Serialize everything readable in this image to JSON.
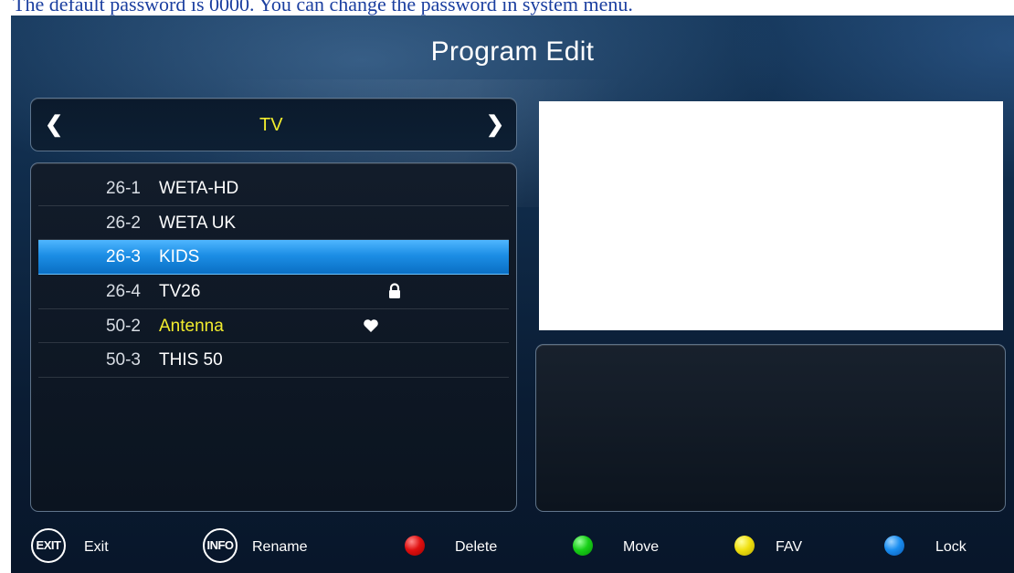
{
  "note": "The default password is 0000. You can change the password in system menu.",
  "screen": {
    "title": "Program Edit",
    "group": {
      "label": "TV",
      "prev_icon": "chevron-left-icon",
      "next_icon": "chevron-right-icon"
    },
    "channels": [
      {
        "number": "26-1",
        "name": "WETA-HD"
      },
      {
        "number": "26-2",
        "name": "WETA UK"
      },
      {
        "number": "26-3",
        "name": "KIDS",
        "selected": true
      },
      {
        "number": "26-4",
        "name": "TV26",
        "flag_icon": "lock-icon"
      },
      {
        "number": "50-2",
        "name": "Antenna",
        "favorite": true,
        "flag_icon": "heart-icon"
      },
      {
        "number": "50-3",
        "name": "THIS 50"
      }
    ],
    "footer": {
      "exit": {
        "button": "EXIT",
        "label": "Exit"
      },
      "info": {
        "button": "INFO",
        "label": "Rename"
      },
      "delete": {
        "label": "Delete",
        "color": "#e01010"
      },
      "move": {
        "label": "Move",
        "color": "#18d018"
      },
      "fav": {
        "label": "FAV",
        "color": "#f0e010"
      },
      "lock": {
        "label": "Lock",
        "color": "#1a8ef0"
      }
    }
  },
  "colors": {
    "accent_yellow": "#f2ec2e",
    "selection_blue": "#1c8ee5"
  }
}
